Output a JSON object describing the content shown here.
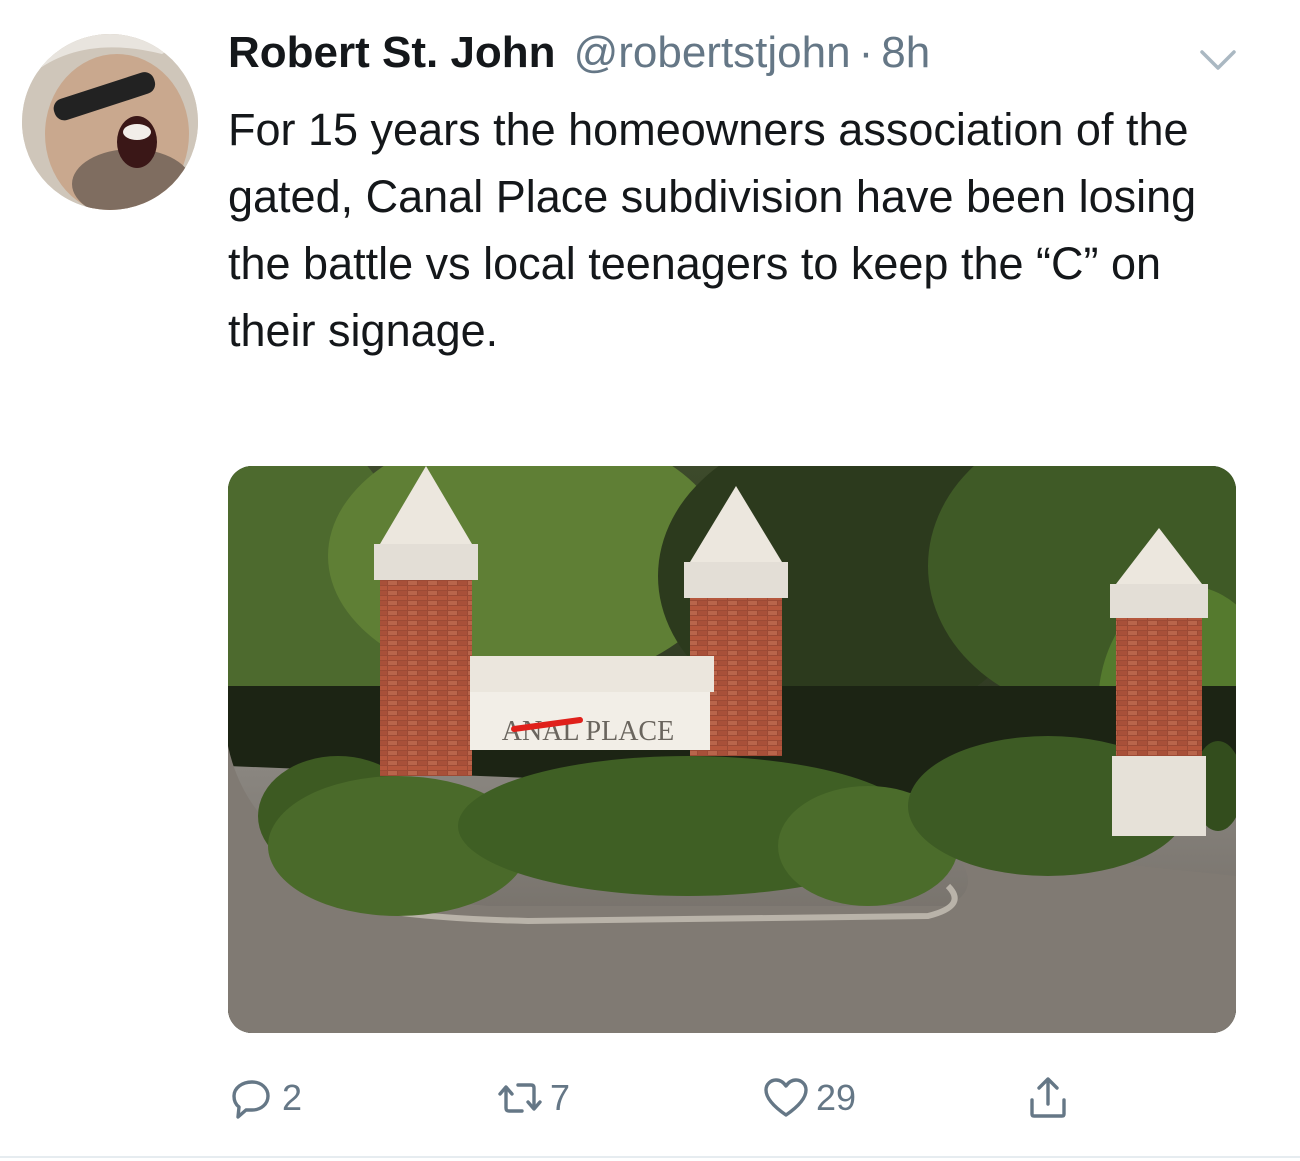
{
  "tweet": {
    "author_name": "Robert St. John",
    "handle": "@robertstjohn",
    "separator": "·",
    "time_ago": "8h",
    "text": "For 15 years the homeowners association of the gated, Canal Place subdivision have been losing the battle vs local teenagers to keep the “C” on their signage."
  },
  "media": {
    "sign_text": "ANAL PLACE",
    "strike_color": "#e0201b"
  },
  "actions": {
    "replies": "2",
    "retweets": "7",
    "likes": "29"
  },
  "colors": {
    "text": "#14171a",
    "secondary": "#657786",
    "divider": "#e6ecf0"
  },
  "icons": [
    "avatar",
    "chevron-down-icon",
    "reply-icon",
    "retweet-icon",
    "like-icon",
    "share-icon"
  ]
}
